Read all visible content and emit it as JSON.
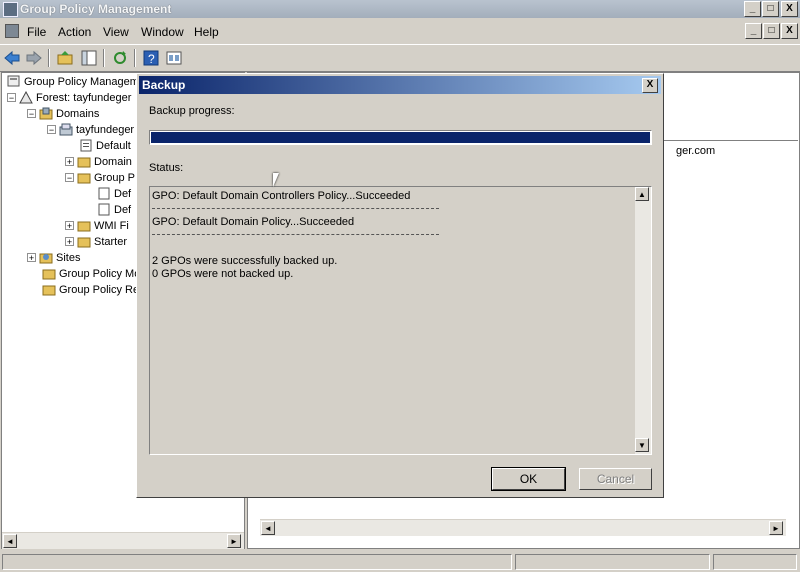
{
  "window": {
    "title": "Group Policy Management",
    "controls": [
      "_",
      "□",
      "X"
    ],
    "mdi_controls": [
      "_",
      "□",
      "X"
    ]
  },
  "menu": [
    "File",
    "Action",
    "View",
    "Window",
    "Help"
  ],
  "tree": {
    "items": [
      {
        "label": "Group Policy Manageme",
        "level": 0,
        "expander": ""
      },
      {
        "label": "Forest: tayfundeger",
        "level": 1,
        "expander": "−"
      },
      {
        "label": "Domains",
        "level": 2,
        "expander": "−"
      },
      {
        "label": "tayfundeger",
        "level": 3,
        "expander": "−"
      },
      {
        "label": "Default",
        "level": 4,
        "expander": ""
      },
      {
        "label": "Domain",
        "level": 4,
        "expander": "+"
      },
      {
        "label": "Group P",
        "level": 4,
        "expander": "−"
      },
      {
        "label": "Def",
        "level": 5,
        "expander": ""
      },
      {
        "label": "Def",
        "level": 5,
        "expander": ""
      },
      {
        "label": "WMI Fi",
        "level": 4,
        "expander": "+"
      },
      {
        "label": "Starter",
        "level": 4,
        "expander": "+"
      },
      {
        "label": "Sites",
        "level": 1,
        "expander": "+"
      },
      {
        "label": "Group Policy Mo",
        "level": 1,
        "expander": ""
      },
      {
        "label": "Group Policy Re",
        "level": 1,
        "expander": ""
      }
    ]
  },
  "right_pane": {
    "visible_text": "ger.com"
  },
  "dialog": {
    "title": "Backup",
    "close": "X",
    "progress_label": "Backup progress:",
    "progress": 1.0,
    "status_label": "Status:",
    "status_lines": [
      "GPO: Default Domain Controllers Policy...Succeeded",
      "GPO: Default Domain Policy...Succeeded",
      "2 GPOs were successfully backed up.",
      "0 GPOs were not backed up."
    ],
    "ok_label": "OK",
    "cancel_label": "Cancel"
  },
  "colors": {
    "dialog_title": "#0a246a",
    "progress": "#0a246a"
  }
}
